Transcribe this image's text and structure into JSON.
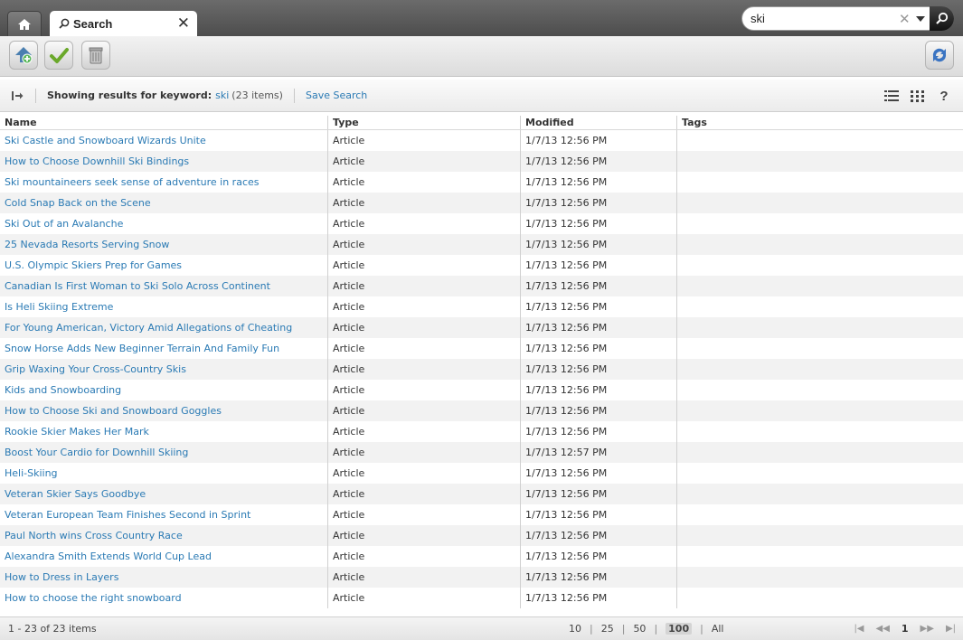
{
  "tabs": {
    "search_label": "Search"
  },
  "search": {
    "value": "ski"
  },
  "info": {
    "showing_label": "Showing results for keyword:",
    "keyword": "ski",
    "count": "(23 items)",
    "save_search": "Save Search",
    "help": "?"
  },
  "columns": [
    "Name",
    "Type",
    "Modified",
    "Tags"
  ],
  "rows": [
    {
      "name": "Ski Castle and Snowboard Wizards Unite",
      "type": "Article",
      "modified": "1/7/13 12:56 PM",
      "tags": ""
    },
    {
      "name": "How to Choose Downhill Ski Bindings",
      "type": "Article",
      "modified": "1/7/13 12:56 PM",
      "tags": ""
    },
    {
      "name": "Ski mountaineers seek sense of adventure in races",
      "type": "Article",
      "modified": "1/7/13 12:56 PM",
      "tags": ""
    },
    {
      "name": "Cold Snap Back on the Scene",
      "type": "Article",
      "modified": "1/7/13 12:56 PM",
      "tags": ""
    },
    {
      "name": "Ski Out of an Avalanche",
      "type": "Article",
      "modified": "1/7/13 12:56 PM",
      "tags": ""
    },
    {
      "name": "25 Nevada Resorts Serving Snow",
      "type": "Article",
      "modified": "1/7/13 12:56 PM",
      "tags": ""
    },
    {
      "name": "U.S. Olympic Skiers Prep for Games",
      "type": "Article",
      "modified": "1/7/13 12:56 PM",
      "tags": ""
    },
    {
      "name": "Canadian Is First Woman to Ski Solo Across Continent",
      "type": "Article",
      "modified": "1/7/13 12:56 PM",
      "tags": ""
    },
    {
      "name": "Is Heli Skiing Extreme",
      "type": "Article",
      "modified": "1/7/13 12:56 PM",
      "tags": ""
    },
    {
      "name": "For Young American, Victory Amid Allegations of Cheating",
      "type": "Article",
      "modified": "1/7/13 12:56 PM",
      "tags": ""
    },
    {
      "name": "Snow Horse Adds New Beginner Terrain And Family Fun",
      "type": "Article",
      "modified": "1/7/13 12:56 PM",
      "tags": ""
    },
    {
      "name": "Grip Waxing Your Cross-Country Skis",
      "type": "Article",
      "modified": "1/7/13 12:56 PM",
      "tags": ""
    },
    {
      "name": "Kids and Snowboarding",
      "type": "Article",
      "modified": "1/7/13 12:56 PM",
      "tags": ""
    },
    {
      "name": "How to Choose Ski and Snowboard Goggles",
      "type": "Article",
      "modified": "1/7/13 12:56 PM",
      "tags": ""
    },
    {
      "name": "Rookie Skier Makes Her Mark",
      "type": "Article",
      "modified": "1/7/13 12:56 PM",
      "tags": ""
    },
    {
      "name": "Boost Your Cardio for Downhill Skiing",
      "type": "Article",
      "modified": "1/7/13 12:57 PM",
      "tags": ""
    },
    {
      "name": "Heli-Skiing",
      "type": "Article",
      "modified": "1/7/13 12:56 PM",
      "tags": ""
    },
    {
      "name": "Veteran Skier Says Goodbye",
      "type": "Article",
      "modified": "1/7/13 12:56 PM",
      "tags": ""
    },
    {
      "name": "Veteran European Team Finishes Second in Sprint",
      "type": "Article",
      "modified": "1/7/13 12:56 PM",
      "tags": ""
    },
    {
      "name": "Paul North wins Cross Country Race",
      "type": "Article",
      "modified": "1/7/13 12:56 PM",
      "tags": ""
    },
    {
      "name": "Alexandra Smith Extends World Cup Lead",
      "type": "Article",
      "modified": "1/7/13 12:56 PM",
      "tags": ""
    },
    {
      "name": "How to Dress in Layers",
      "type": "Article",
      "modified": "1/7/13 12:56 PM",
      "tags": ""
    },
    {
      "name": "How to choose the right snowboard",
      "type": "Article",
      "modified": "1/7/13 12:56 PM",
      "tags": ""
    }
  ],
  "footer": {
    "range": "1 - 23 of 23 items",
    "page_sizes": [
      "10",
      "25",
      "50",
      "100",
      "All"
    ],
    "selected_page_size": "100",
    "current_page": "1"
  },
  "icons": {
    "home": "home-icon",
    "search": "search-icon",
    "close": "close-icon",
    "add": "add-icon",
    "approve": "check-icon",
    "delete": "trash-icon",
    "sync": "sync-icon"
  },
  "colors": {
    "link": "#2a7ab4",
    "topbar": "#5a5a5a",
    "alt_row": "#f2f2f2"
  }
}
